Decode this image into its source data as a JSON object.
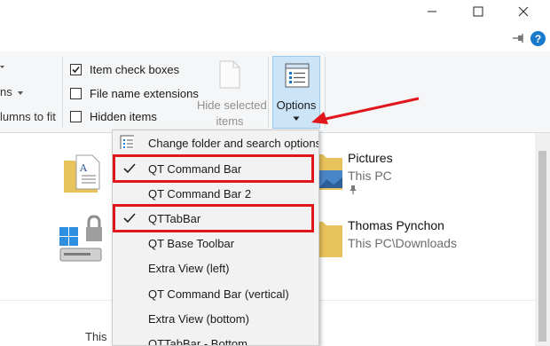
{
  "window": {
    "minimize_icon": "minimize-icon",
    "maximize_icon": "maximize-icon",
    "close_icon": "close-icon",
    "pin_icon": "pin-ribbon-icon",
    "help_icon": "help-icon",
    "help_label": "?"
  },
  "ribbon": {
    "partial_left": {
      "line1": "ns",
      "line2": "lumns to fit"
    },
    "show_hide": {
      "item_check_boxes": {
        "label": "Item check boxes",
        "checked": true
      },
      "file_name_extensions": {
        "label": "File name extensions",
        "checked": false
      },
      "hidden_items": {
        "label": "Hidden items",
        "checked": false
      }
    },
    "hide_selected": {
      "line1": "Hide selected",
      "line2": "items"
    },
    "options": {
      "label": "Options"
    }
  },
  "content": {
    "items": [
      {
        "name": "Pictures",
        "sub": "This PC"
      },
      {
        "name": "Thomas Pynchon",
        "sub": "This PC\\Downloads"
      }
    ],
    "footer_text": "This"
  },
  "menu": {
    "items": [
      {
        "label": "Change folder and search options",
        "icon": "folder-options-icon",
        "checked": false
      },
      {
        "label": "QT Command Bar",
        "checked": true,
        "highlighted": true
      },
      {
        "label": "QT Command Bar 2",
        "checked": false
      },
      {
        "label": "QTTabBar",
        "checked": true,
        "highlighted": true
      },
      {
        "label": "QT Base Toolbar",
        "checked": false
      },
      {
        "label": "Extra View (left)",
        "checked": false
      },
      {
        "label": "QT Command Bar (vertical)",
        "checked": false
      },
      {
        "label": "Extra View (bottom)",
        "checked": false
      },
      {
        "label": "QTTabBar - Bottom",
        "checked": false
      }
    ]
  },
  "colors": {
    "annotation_red": "#e0161c",
    "options_highlight": "#cce4f7",
    "help_blue": "#1979ca"
  }
}
